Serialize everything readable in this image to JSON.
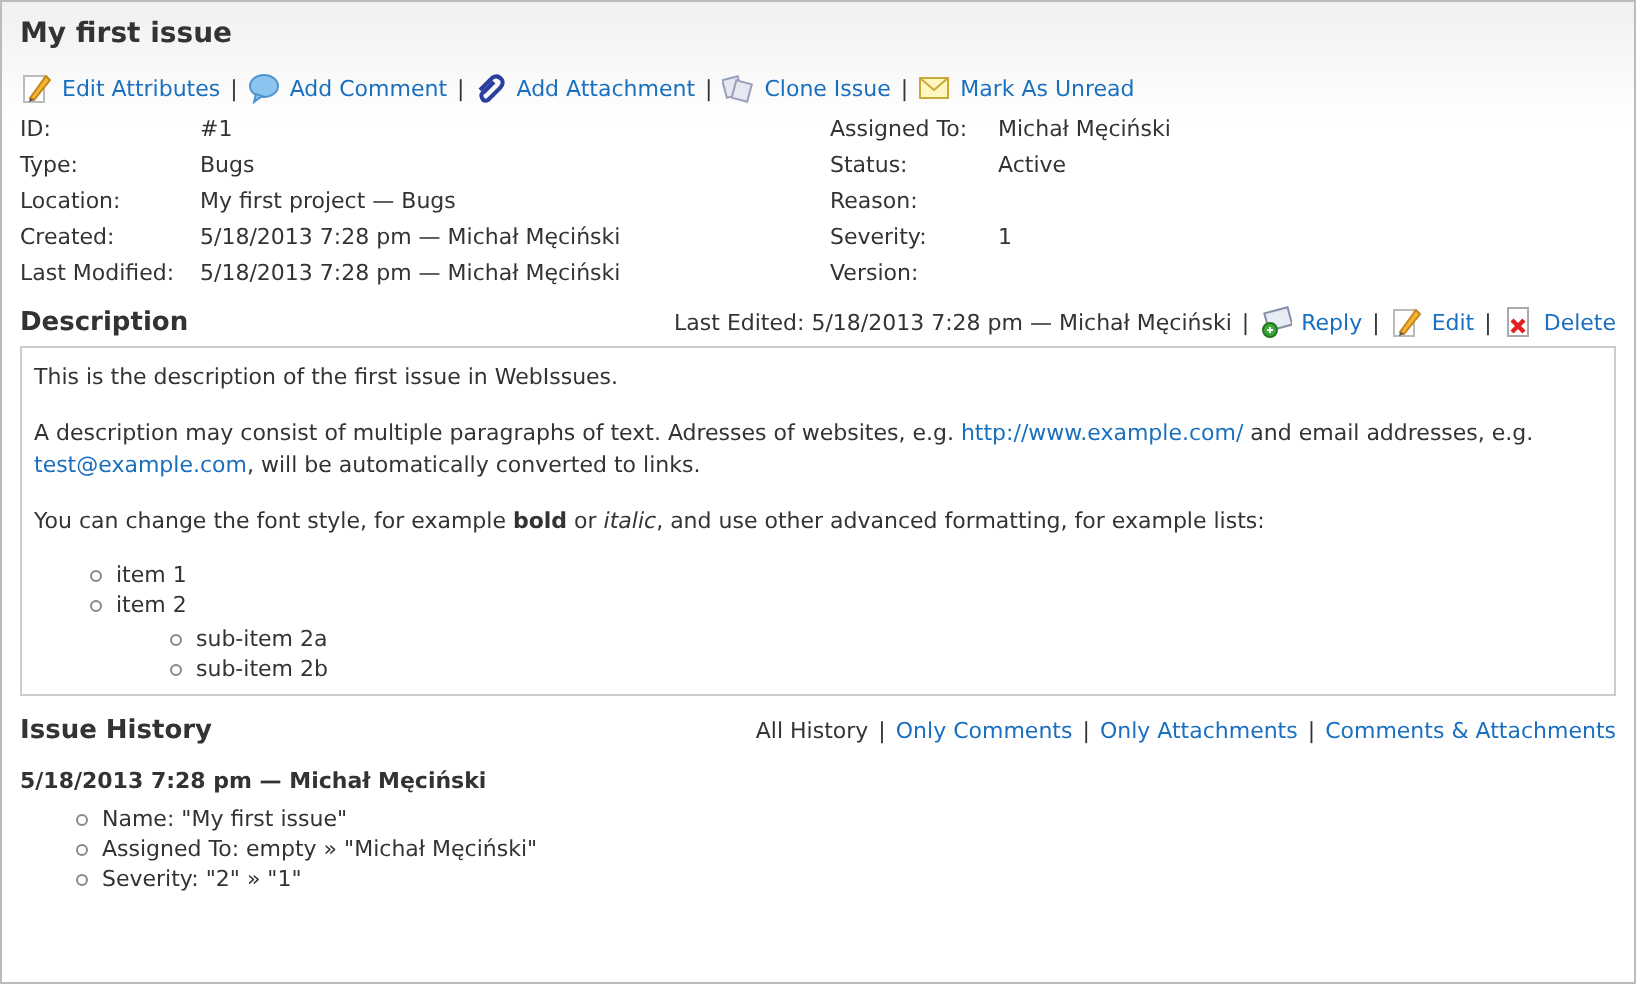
{
  "title": "My first issue",
  "toolbar": {
    "separator": "|",
    "items": [
      {
        "label": "Edit Attributes",
        "kind": "edit"
      },
      {
        "label": "Add Comment",
        "kind": "comment"
      },
      {
        "label": "Add Attachment",
        "kind": "attach"
      },
      {
        "label": "Clone Issue",
        "kind": "clone"
      },
      {
        "label": "Mark As Unread",
        "kind": "mail"
      }
    ]
  },
  "properties_left": [
    {
      "label": "ID:",
      "value": "#1"
    },
    {
      "label": "Type:",
      "value": "Bugs"
    },
    {
      "label": "Location:",
      "value": "My first project — Bugs"
    },
    {
      "label": "Created:",
      "value": "5/18/2013 7:28 pm — Michał Męciński"
    },
    {
      "label": "Last Modified:",
      "value": "5/18/2013 7:28 pm — Michał Męciński"
    }
  ],
  "properties_right": [
    {
      "label": "Assigned To:",
      "value": "Michał Męciński"
    },
    {
      "label": "Status:",
      "value": "Active"
    },
    {
      "label": "Reason:"
    },
    {
      "label": "Severity:",
      "value": "1"
    },
    {
      "label": "Version:"
    }
  ],
  "description": {
    "heading": "Description",
    "last_edited": "Last Edited: 5/18/2013 7:28 pm — Michał Męciński",
    "separator": "|",
    "actions": [
      {
        "label": "Reply",
        "kind": "reply"
      },
      {
        "label": "Edit",
        "kind": "edit"
      },
      {
        "label": "Delete",
        "kind": "delete"
      }
    ],
    "paragraphs": [
      [
        {
          "kind": "text",
          "text": "This is the description of the first issue in WebIssues."
        }
      ],
      [
        {
          "kind": "text",
          "text": "A description may consist of multiple paragraphs of text. Adresses of websites, e.g. "
        },
        {
          "kind": "link",
          "text": "http://www.example.com/"
        },
        {
          "kind": "text",
          "text": " and email addresses, e.g. "
        },
        {
          "kind": "link",
          "text": "test@example.com"
        },
        {
          "kind": "text",
          "text": ", will be automatically converted to links."
        }
      ],
      [
        {
          "kind": "text",
          "text": "You can change the font style, for example **bold** or *italic*, and use other advanced formatting, for example lists:"
        }
      ]
    ],
    "list": [
      {
        "text": "item 1"
      },
      {
        "text": "item 2",
        "children": [
          {
            "text": "sub-item 2a"
          },
          {
            "text": "sub-item 2b"
          }
        ]
      }
    ]
  },
  "history": {
    "heading": "Issue History",
    "separator": "|",
    "filters": [
      {
        "label": "All History",
        "selected": true
      },
      {
        "label": "Only Comments",
        "selected": false
      },
      {
        "label": "Only Attachments",
        "selected": false
      },
      {
        "label": "Comments & Attachments",
        "selected": false
      }
    ],
    "entries": [
      {
        "header": "5/18/2013 7:28 pm — Michał Męciński",
        "changes": [
          "Name: \"My first issue\"",
          "Assigned To: empty » \"Michał Męciński\"",
          "Severity: \"2\" » \"1\""
        ]
      }
    ]
  }
}
